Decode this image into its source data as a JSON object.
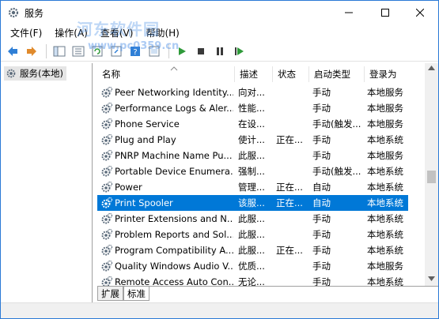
{
  "window": {
    "title": "服务"
  },
  "watermark": {
    "line1": "河东软件园",
    "line2": "www.pc0359.cn"
  },
  "menu": [
    {
      "label": "文件(F)"
    },
    {
      "label": "操作(A)"
    },
    {
      "label": "查看(V)"
    },
    {
      "label": "帮助(H)"
    }
  ],
  "tree": {
    "label": "服务(本地)"
  },
  "columns": {
    "name": "名称",
    "desc": "描述",
    "status": "状态",
    "startup": "启动类型",
    "logon": "登录为"
  },
  "rows": [
    {
      "name": "Peer Networking Identity...",
      "desc": "向对...",
      "status": "",
      "startup": "手动",
      "logon": "本地服务"
    },
    {
      "name": "Performance Logs & Aler...",
      "desc": "性能...",
      "status": "",
      "startup": "手动",
      "logon": "本地服务"
    },
    {
      "name": "Phone Service",
      "desc": "在设...",
      "status": "",
      "startup": "手动(触发...",
      "logon": "本地服务"
    },
    {
      "name": "Plug and Play",
      "desc": "使计...",
      "status": "正在...",
      "startup": "手动",
      "logon": "本地系统"
    },
    {
      "name": "PNRP Machine Name Pu...",
      "desc": "此服...",
      "status": "",
      "startup": "手动",
      "logon": "本地服务"
    },
    {
      "name": "Portable Device Enumera...",
      "desc": "强制...",
      "status": "",
      "startup": "手动(触发...",
      "logon": "本地系统"
    },
    {
      "name": "Power",
      "desc": "管理...",
      "status": "正在...",
      "startup": "自动",
      "logon": "本地系统"
    },
    {
      "name": "Print Spooler",
      "desc": "该服...",
      "status": "正在...",
      "startup": "自动",
      "logon": "本地系统"
    },
    {
      "name": "Printer Extensions and N...",
      "desc": "此服...",
      "status": "",
      "startup": "手动",
      "logon": "本地系统"
    },
    {
      "name": "Problem Reports and Sol...",
      "desc": "此服...",
      "status": "",
      "startup": "手动",
      "logon": "本地系统"
    },
    {
      "name": "Program Compatibility A...",
      "desc": "此服...",
      "status": "正在...",
      "startup": "手动",
      "logon": "本地系统"
    },
    {
      "name": "Quality Windows Audio V...",
      "desc": "优质...",
      "status": "",
      "startup": "手动",
      "logon": "本地服务"
    },
    {
      "name": "Remote Access Auto Con...",
      "desc": "无论...",
      "status": "",
      "startup": "手动",
      "logon": "本地系统"
    }
  ],
  "selected_row": 7,
  "tabs": [
    {
      "label": "扩展"
    },
    {
      "label": "标准"
    }
  ],
  "colors": {
    "accent": "#0078d7",
    "border": "#2b79d6"
  }
}
